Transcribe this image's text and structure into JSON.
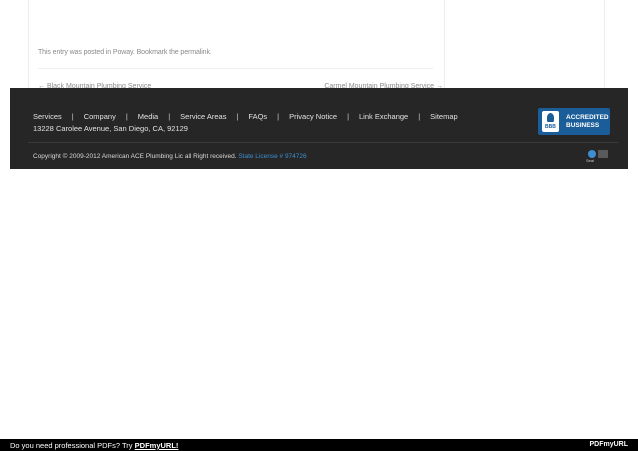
{
  "post": {
    "entry_meta": "This entry was posted in Poway. Bookmark the permalink.",
    "nav_prev": "← Black Mountain Plumbing Service",
    "nav_next": "Carmel Mountain Plumbing Service →"
  },
  "footer": {
    "links": [
      "Services",
      "Company",
      "Media",
      "Service Areas",
      "FAQs",
      "Privacy Notice",
      "Link Exchange",
      "Sitemap"
    ],
    "separator": "|",
    "address": "13228 Carolee Avenue, San Diego, CA, 92129",
    "copyright": "Copyright © 2009-2012 American ACE Plumbing Lic all Right received.",
    "license": "State License # 974726"
  },
  "badges": {
    "bbb_label": "BBB",
    "bbb_line1": "ACCREDITED",
    "bbb_line2": "BUSINESS",
    "ssl_label": "Seal"
  },
  "bottom_bar": {
    "promo_text": "Do you need professional PDFs? Try",
    "promo_link": "PDFmyURL!",
    "logo": "PDFmyURL"
  },
  "colors": {
    "footer_bg": "#262626",
    "license_link": "#3f8fd0",
    "bbb_blue": "#1a5d98"
  }
}
